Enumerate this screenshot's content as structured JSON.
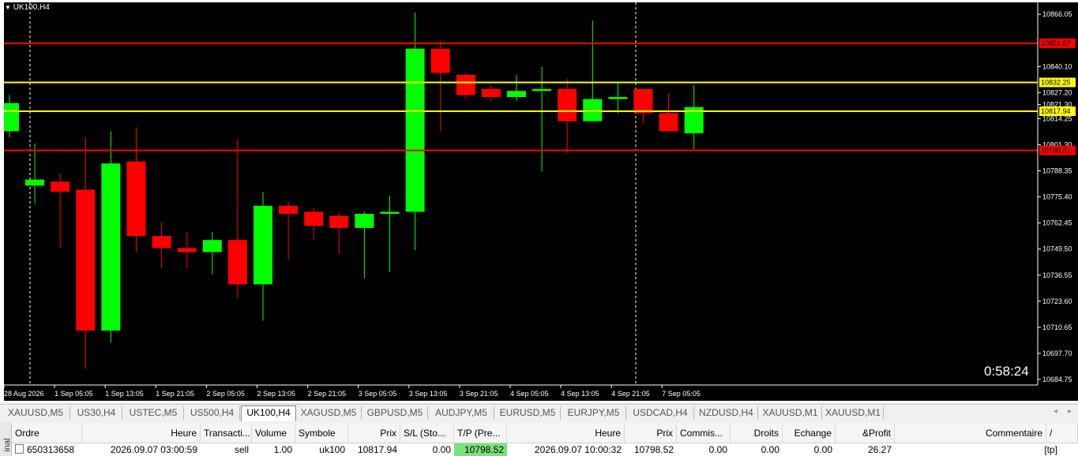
{
  "chart": {
    "symbol_label": "UK100,H4",
    "timer": "0:58:24",
    "colors": {
      "bg": "#000000",
      "bull": "#00ff00",
      "bear": "#ff0000",
      "wick_bull": "#00ff00",
      "wick_bear": "#ff0000",
      "grid": "#ffffff",
      "axis": "#ffffff",
      "level_red": "#ff0000",
      "level_yellow": "#ffff00"
    },
    "price_axis": {
      "labels": [
        "10866.05",
        "10840.10",
        "10827.20",
        "10821.30",
        "10814.25",
        "10801.30",
        "10788.35",
        "10775.40",
        "10762.45",
        "10749.50",
        "10736.55",
        "10723.60",
        "10710.65",
        "10697.70",
        "10684.75"
      ],
      "ylim": [
        10682,
        10872
      ]
    },
    "time_axis": {
      "labels": [
        "28 Aug 2026",
        "1 Sep 05:05",
        "1 Sep 13:05",
        "1 Sep 21:05",
        "2 Sep 05:05",
        "2 Sep 13:05",
        "2 Sep 21:05",
        "3 Sep 05:05",
        "3 Sep 13:05",
        "3 Sep 21:05",
        "4 Sep 05:05",
        "4 Sep 13:05",
        "4 Sep 21:05",
        "7 Sep 05:05"
      ]
    },
    "levels": [
      {
        "price": 10851.67,
        "label": "10851.67",
        "color": "red"
      },
      {
        "price": 10832.25,
        "label": "10832.25",
        "color": "yellow"
      },
      {
        "price": 10817.94,
        "label": "10817.94",
        "color": "yellow"
      },
      {
        "price": 10798.52,
        "label": "10798.52",
        "color": "red"
      }
    ],
    "candles": [
      {
        "o": 10808,
        "h": 10826,
        "l": 10805,
        "c": 10822
      },
      {
        "o": 10781,
        "h": 10802,
        "l": 10772,
        "c": 10784
      },
      {
        "o": 10783,
        "h": 10787,
        "l": 10750,
        "c": 10778
      },
      {
        "o": 10779,
        "h": 10805,
        "l": 10690,
        "c": 10709
      },
      {
        "o": 10709,
        "h": 10808,
        "l": 10703,
        "c": 10792
      },
      {
        "o": 10793,
        "h": 10810,
        "l": 10748,
        "c": 10756
      },
      {
        "o": 10756,
        "h": 10763,
        "l": 10740,
        "c": 10750
      },
      {
        "o": 10750,
        "h": 10758,
        "l": 10740,
        "c": 10748
      },
      {
        "o": 10748,
        "h": 10758,
        "l": 10737,
        "c": 10754
      },
      {
        "o": 10754,
        "h": 10804,
        "l": 10725,
        "c": 10732
      },
      {
        "o": 10732,
        "h": 10778,
        "l": 10714,
        "c": 10771
      },
      {
        "o": 10771,
        "h": 10773,
        "l": 10744,
        "c": 10767
      },
      {
        "o": 10768,
        "h": 10770,
        "l": 10754,
        "c": 10761
      },
      {
        "o": 10766,
        "h": 10768,
        "l": 10747,
        "c": 10760
      },
      {
        "o": 10760,
        "h": 10768,
        "l": 10735,
        "c": 10767
      },
      {
        "o": 10767,
        "h": 10776,
        "l": 10738,
        "c": 10768
      },
      {
        "o": 10768,
        "h": 10867,
        "l": 10749,
        "c": 10849
      },
      {
        "o": 10849,
        "h": 10853,
        "l": 10808,
        "c": 10837
      },
      {
        "o": 10836,
        "h": 10837,
        "l": 10824,
        "c": 10826
      },
      {
        "o": 10829,
        "h": 10831,
        "l": 10823,
        "c": 10825
      },
      {
        "o": 10825,
        "h": 10836,
        "l": 10823,
        "c": 10828
      },
      {
        "o": 10828,
        "h": 10840,
        "l": 10788,
        "c": 10829
      },
      {
        "o": 10829,
        "h": 10834,
        "l": 10797,
        "c": 10813
      },
      {
        "o": 10813,
        "h": 10863,
        "l": 10813,
        "c": 10824
      },
      {
        "o": 10824,
        "h": 10832,
        "l": 10817,
        "c": 10825
      },
      {
        "o": 10829,
        "h": 10829,
        "l": 10812,
        "c": 10817
      },
      {
        "o": 10817,
        "h": 10827,
        "l": 10808,
        "c": 10808
      },
      {
        "o": 10807,
        "h": 10831,
        "l": 10799,
        "c": 10820
      }
    ]
  },
  "tabs": {
    "items": [
      "XAUUSD,M5",
      "US30,H4",
      "USTEC,M5",
      "US500,H4",
      "UK100,H4",
      "XAGUSD,M5",
      "GBPUSD,M5",
      "AUDJPY,M5",
      "EURUSD,M5",
      "EURJPY,M5",
      "USDCAD,H4",
      "NZDUSD,H4",
      "XAUUSD,M1",
      "XAUUSD,M1"
    ],
    "active_index": 4,
    "left_arrow": "◂",
    "right_arrow": "▸"
  },
  "terminal": {
    "side_label": "inal",
    "headers": [
      "Ordre",
      "Heure",
      "Transacti...",
      "Volume",
      "Symbole",
      "Prix",
      "S/L (Sto...",
      "T/P (Pre...",
      "Heure",
      "Prix",
      "Commis...",
      "Droits",
      "Echange",
      "&Profit",
      "Commentaire"
    ],
    "sort_icon": "/",
    "row": {
      "order": "650313658",
      "open_time": "2026.09.07 03:00:59",
      "type": "sell",
      "volume": "1.00",
      "symbol": "uk100",
      "open_price": "10817.94",
      "sl": "0.00",
      "tp": "10798.52",
      "time": "2026.09.07 10:00:32",
      "price": "10798.52",
      "commission": "0.00",
      "taxes": "0.00",
      "swap": "0.00",
      "profit": "26.27",
      "comment": "[tp]"
    }
  }
}
